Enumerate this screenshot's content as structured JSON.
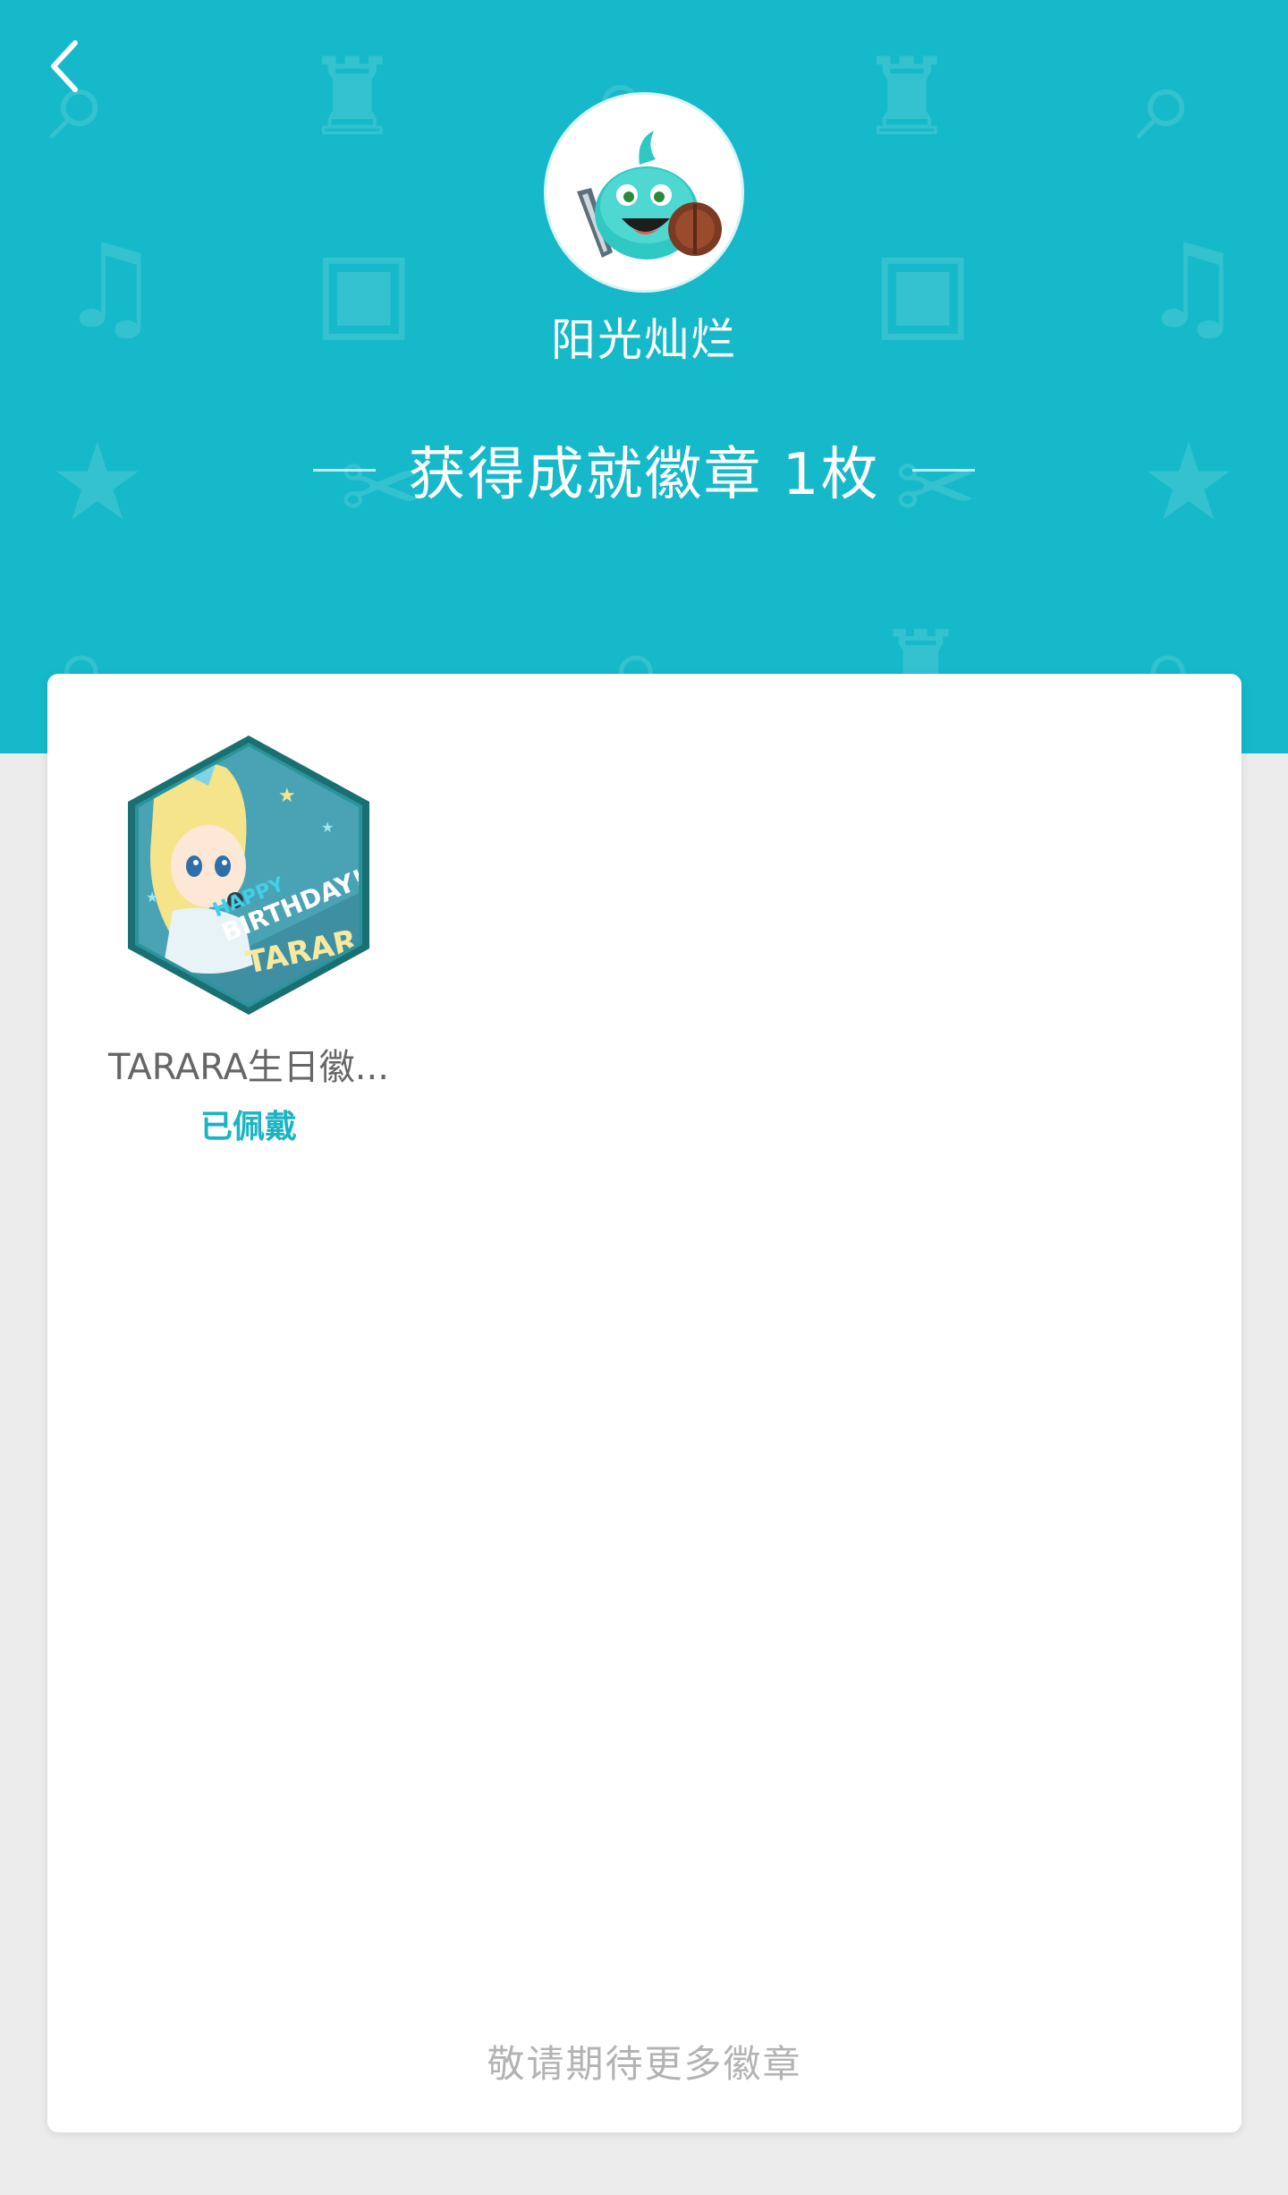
{
  "header": {
    "user_name": "阳光灿烂",
    "achievement_summary": "获得成就徽章 1枚",
    "bg_color": "#16b9c9",
    "background_icons": [
      "search-icon",
      "trophy-icon",
      "music-note-icon",
      "gamepad-icon",
      "star-icon",
      "sword-icon"
    ]
  },
  "badges": [
    {
      "name": "TARARA生日徽...",
      "status": "已佩戴",
      "badge_lines": [
        "HAPPY",
        "BIRTHDAY!",
        "TARARA"
      ]
    }
  ],
  "footer": {
    "note": "敬请期待更多徽章"
  },
  "colors": {
    "accent": "#1ab4c3",
    "page_bg": "#ececec",
    "card_bg": "#ffffff"
  }
}
